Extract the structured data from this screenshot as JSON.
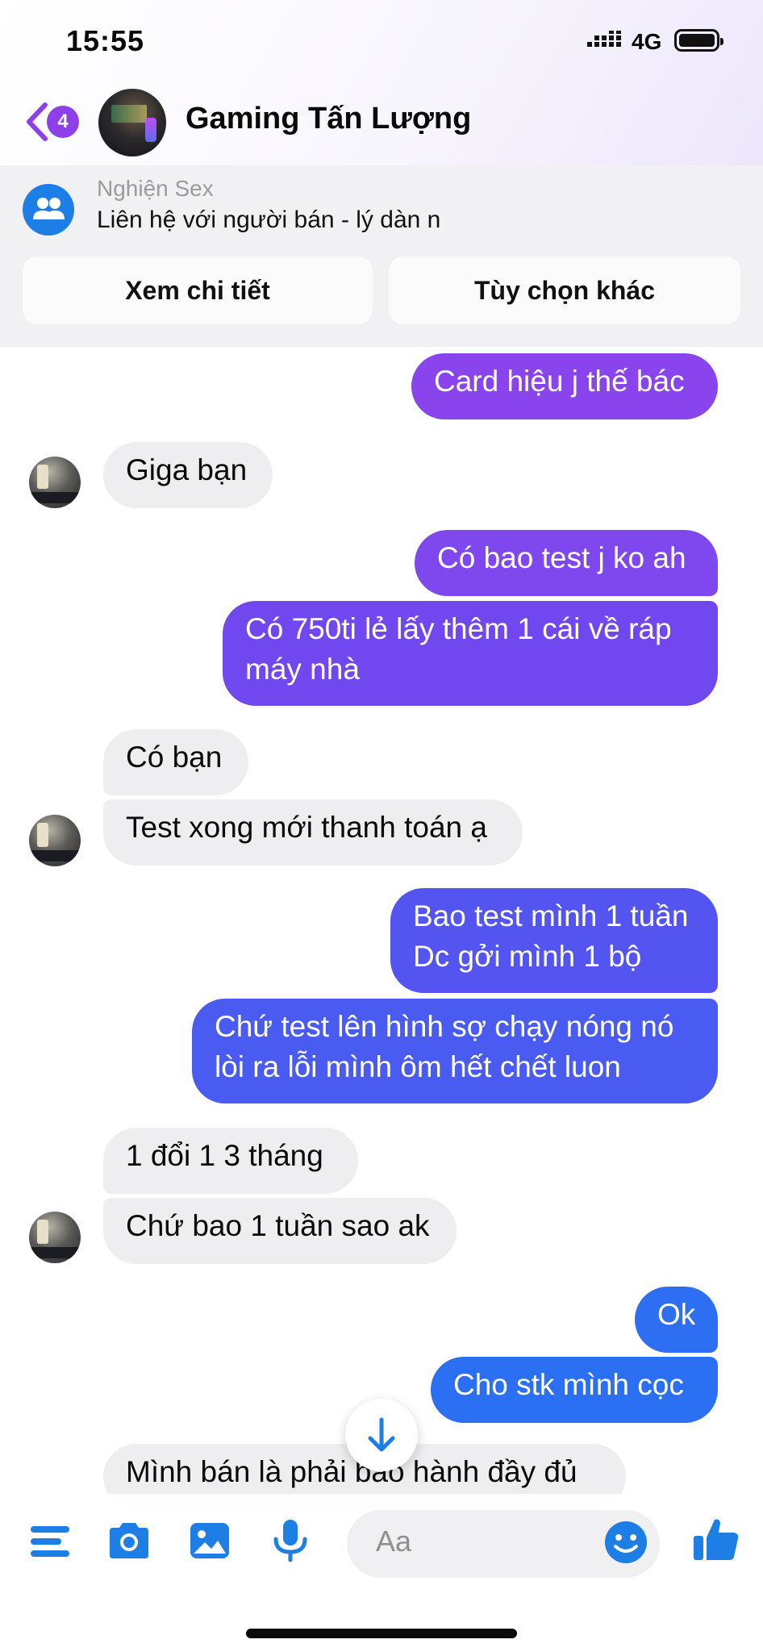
{
  "status_bar": {
    "time": "15:55",
    "network": "4G"
  },
  "header": {
    "unread_count": "4",
    "contact_name": "Gaming Tấn Lượng"
  },
  "context": {
    "group_name": "Nghiện Sex",
    "listing_text": "Liên hệ với người bán - lý dàn n",
    "view_details": "Xem chi tiết",
    "more_options": "Tùy chọn khác"
  },
  "messages": [
    {
      "dir": "out",
      "lines": [
        "Card hiệu j thế bác"
      ]
    },
    {
      "dir": "in",
      "lines": [
        "Giga bạn"
      ]
    },
    {
      "dir": "out",
      "lines": [
        "Có bao test j ko ah"
      ]
    },
    {
      "dir": "out",
      "lines": [
        "Có 750ti lẻ lấy thêm 1 cái về ráp",
        "máy nhà"
      ]
    },
    {
      "dir": "in",
      "lines": [
        "Có bạn"
      ]
    },
    {
      "dir": "in",
      "lines": [
        "Test xong mới thanh toán ạ"
      ]
    },
    {
      "dir": "out",
      "lines": [
        "Bao test mình 1 tuần",
        "Dc gởi mình 1 bộ"
      ]
    },
    {
      "dir": "out",
      "lines": [
        "Chứ test lên hình sợ chạy nóng nó",
        "lòi ra lỗi mình ôm hết chết luon"
      ]
    },
    {
      "dir": "in",
      "lines": [
        "1 đổi  1 3 tháng"
      ]
    },
    {
      "dir": "in",
      "lines": [
        "Chứ bao 1 tuần sao ak"
      ]
    },
    {
      "dir": "out",
      "lines": [
        "Ok"
      ]
    },
    {
      "dir": "out",
      "lines": [
        "Cho stk mình cọc"
      ]
    },
    {
      "dir": "in",
      "lines": [
        "Mình bán là phải bao hành đầy đủ"
      ]
    }
  ],
  "composer": {
    "placeholder": "Aa"
  },
  "icons": {
    "back": "chevron-left-icon",
    "group": "group-icon",
    "menu": "menu-icon",
    "camera": "camera-icon",
    "gallery": "image-icon",
    "mic": "microphone-icon",
    "emoji": "emoji-icon",
    "like": "thumbs-up-icon",
    "scroll": "arrow-down-icon"
  },
  "colors": {
    "accent_purple": "#8d3fe8",
    "accent_blue": "#1d7fe6",
    "bubble_out_top": "#8a43ee",
    "bubble_out_bottom": "#2f6cf2",
    "bubble_in": "#eeeef0"
  }
}
